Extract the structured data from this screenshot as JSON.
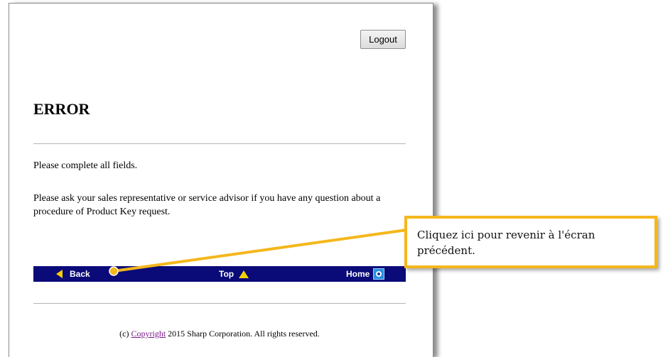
{
  "header": {
    "logout_label": "Logout"
  },
  "main": {
    "title": "ERROR",
    "messages": [
      "Please complete all fields.",
      "Please ask your sales representative or service advisor if you have any question about a procedure of Product Key request."
    ]
  },
  "nav": {
    "back_label": "Back",
    "top_label": "Top",
    "home_label": "Home"
  },
  "footer": {
    "prefix": "(c)",
    "link_label": "Copyright",
    "suffix": "2015 Sharp Corporation. All rights reserved."
  },
  "callout": {
    "text": "Cliquez ici pour revenir à l'écran précédent.",
    "color": "#f4b71c"
  },
  "colors": {
    "nav_bar": "#0a0a78",
    "nav_arrow": "#f5d000"
  }
}
